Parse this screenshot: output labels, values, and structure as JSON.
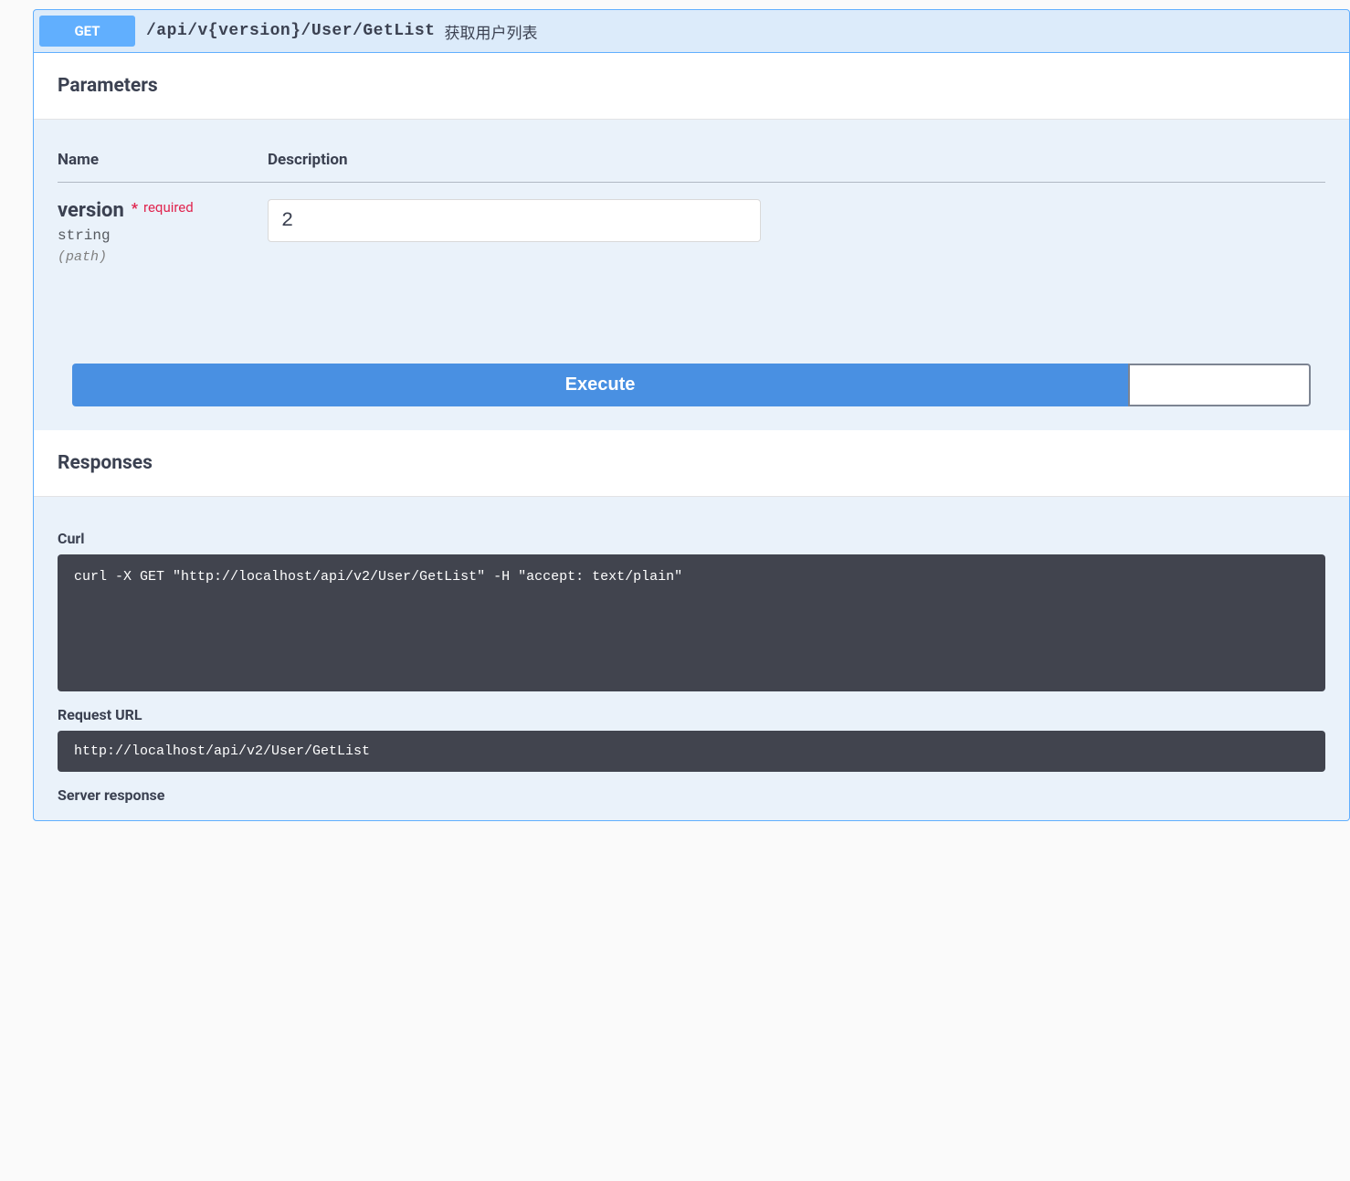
{
  "operation": {
    "method": "GET",
    "path": "/api/v{version}/User/GetList",
    "summary": "获取用户列表"
  },
  "sections": {
    "parameters_title": "Parameters",
    "responses_title": "Responses"
  },
  "params": {
    "col_name": "Name",
    "col_desc": "Description",
    "items": [
      {
        "name": "version",
        "required_star": "*",
        "required_text": "required",
        "type": "string",
        "in": "(path)",
        "value": "2"
      }
    ]
  },
  "buttons": {
    "execute": "Execute"
  },
  "response": {
    "curl_label": "Curl",
    "curl_cmd": "curl -X GET \"http://localhost/api/v2/User/GetList\" -H \"accept: text/plain\"",
    "request_url_label": "Request URL",
    "request_url": "http://localhost/api/v2/User/GetList",
    "server_response_label": "Server response"
  }
}
